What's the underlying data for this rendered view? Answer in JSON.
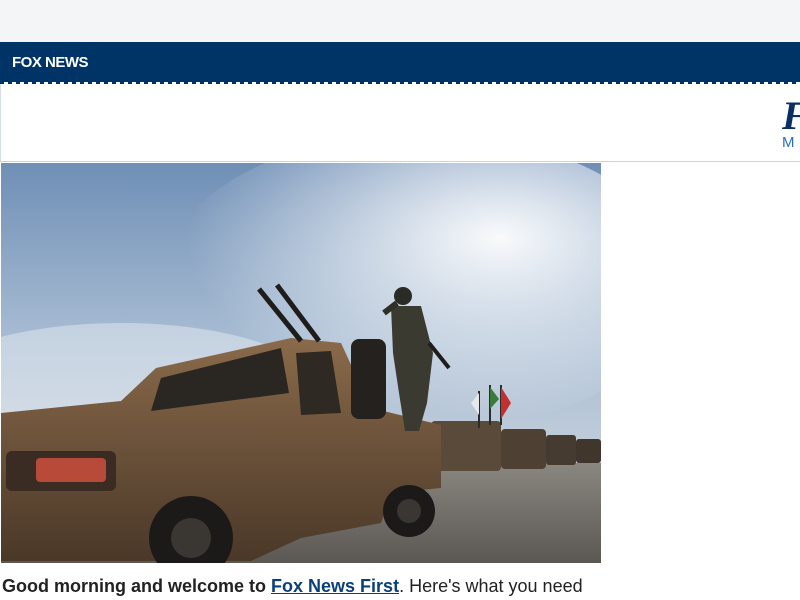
{
  "brand": {
    "logo_text": "FOX NEWS",
    "bar_color": "#003366"
  },
  "header": {
    "big_letter": "F",
    "small_letter": "M"
  },
  "hero": {
    "alt_description_visible": false
  },
  "article": {
    "intro_bold": "Good morning and welcome to",
    "intro_link": "Fox News First",
    "intro_rest": ". Here's what you need"
  }
}
